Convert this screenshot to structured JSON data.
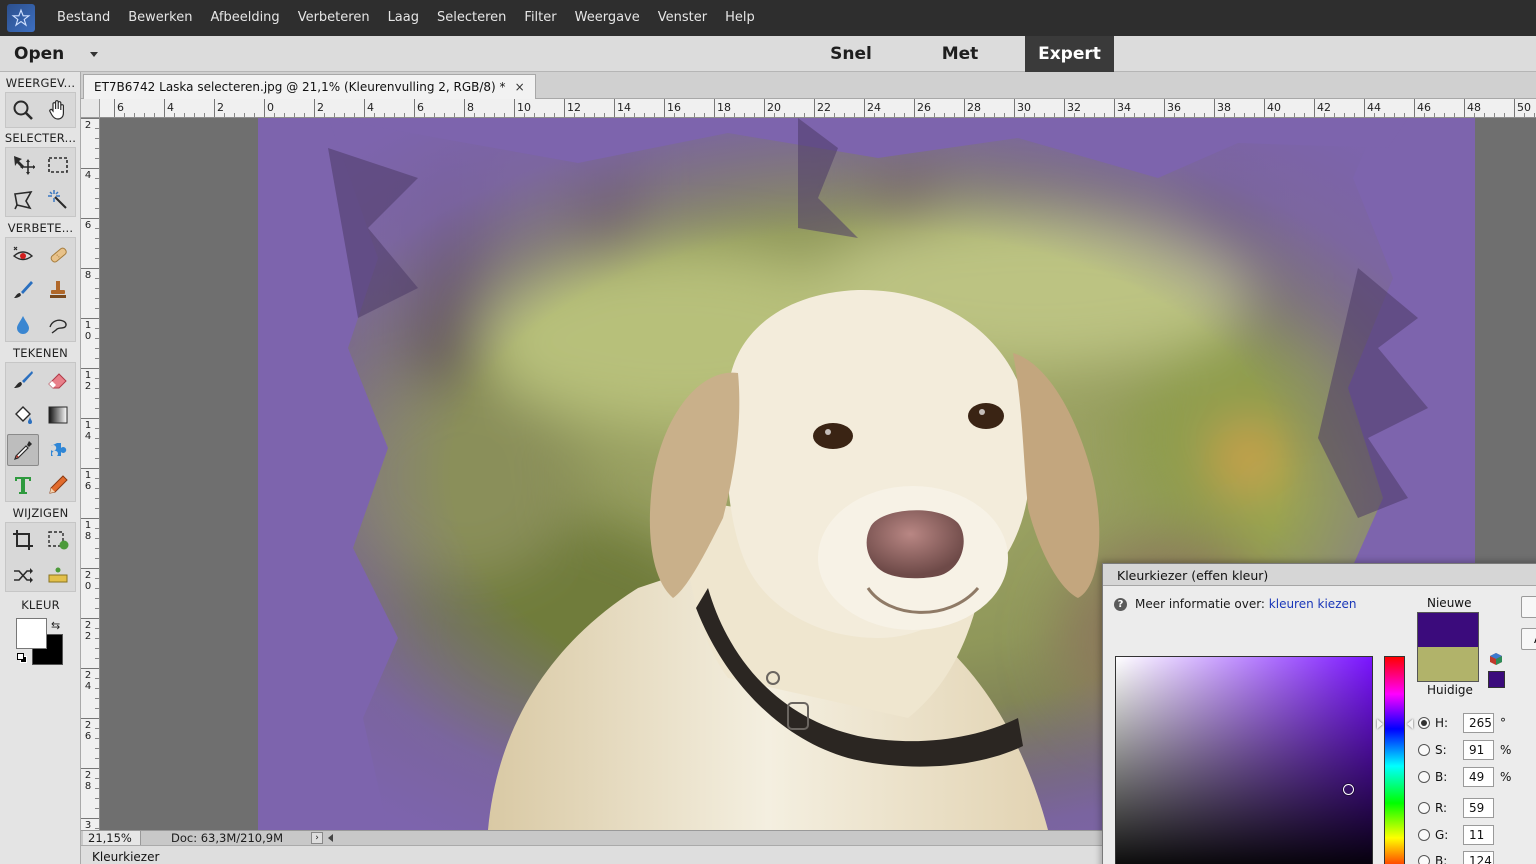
{
  "menu": {
    "items": [
      "Bestand",
      "Bewerken",
      "Afbeelding",
      "Verbeteren",
      "Laag",
      "Selecteren",
      "Filter",
      "Weergave",
      "Venster",
      "Help"
    ]
  },
  "modebar": {
    "open_label": "Open",
    "tabs": [
      "Snel",
      "Met instructies",
      "Expert"
    ],
    "active_tab": "Expert"
  },
  "toolbox": {
    "sections": [
      "WEERGEV...",
      "SELECTER...",
      "VERBETE...",
      "TEKENEN",
      "WIJZIGEN",
      "KLEUR"
    ],
    "tools": [
      "zoom-icon",
      "hand-icon",
      "move-icon",
      "marquee-icon",
      "lasso-icon",
      "magic-wand-icon",
      "red-eye-icon",
      "spot-healing-icon",
      "smart-brush-icon",
      "clone-stamp-icon",
      "blur-icon",
      "smudge-icon",
      "brush-icon",
      "eraser-icon",
      "paint-bucket-icon",
      "gradient-icon",
      "eyedropper-icon",
      "shape-icon",
      "text-icon",
      "pencil-icon",
      "crop-icon",
      "recompose-icon",
      "content-aware-move-icon",
      "straighten-icon"
    ],
    "active_tool": "eyedropper-icon",
    "foreground_color": "#ffffff",
    "background_color": "#000000"
  },
  "document": {
    "tab_title": "ET7B6742 Laska selecteren.jpg @ 21,1% (Kleurenvulling 2, RGB/8) *",
    "close_glyph": "×"
  },
  "rulers": {
    "top_labels": [
      "6",
      "4",
      "2",
      "0",
      "2",
      "4",
      "6",
      "8",
      "10",
      "12",
      "14",
      "16",
      "18",
      "20",
      "22",
      "24",
      "26",
      "28",
      "30",
      "32",
      "34",
      "36",
      "38",
      "40",
      "42",
      "44",
      "46",
      "48",
      "50"
    ],
    "left_labels": [
      "2",
      "4",
      "6",
      "8",
      "10",
      "12",
      "14",
      "16",
      "18",
      "20",
      "22",
      "24",
      "26",
      "28",
      "3"
    ]
  },
  "status": {
    "zoom": "21,15%",
    "doc_info": "Doc: 63,3M/210,9M",
    "arrow_glyph": "›"
  },
  "bottom_panel": {
    "label": "Kleurkiezer"
  },
  "picker": {
    "title": "Kleurkiezer (effen kleur)",
    "help_prefix": "Meer informatie over: ",
    "help_link": "kleuren kiezen",
    "new_label": "Nieuwe",
    "current_label": "Huidige",
    "new_color": "#3b0b7c",
    "current_color": "#b1b36a",
    "channels": [
      {
        "label": "H:",
        "value": "265",
        "unit": "°",
        "selected": true
      },
      {
        "label": "S:",
        "value": "91",
        "unit": "%",
        "selected": false
      },
      {
        "label": "B:",
        "value": "49",
        "unit": "%",
        "selected": false
      },
      {
        "label": "R:",
        "value": "59",
        "unit": "",
        "selected": false
      },
      {
        "label": "G:",
        "value": "11",
        "unit": "",
        "selected": false
      },
      {
        "label": "B:",
        "value": "124",
        "unit": "",
        "selected": false
      }
    ],
    "button_glyph": "A"
  },
  "colors": {
    "border_purple": "#7d64ad",
    "menubar_bg": "#2e2e2e",
    "active_tab_bg": "#3a3a3a"
  }
}
